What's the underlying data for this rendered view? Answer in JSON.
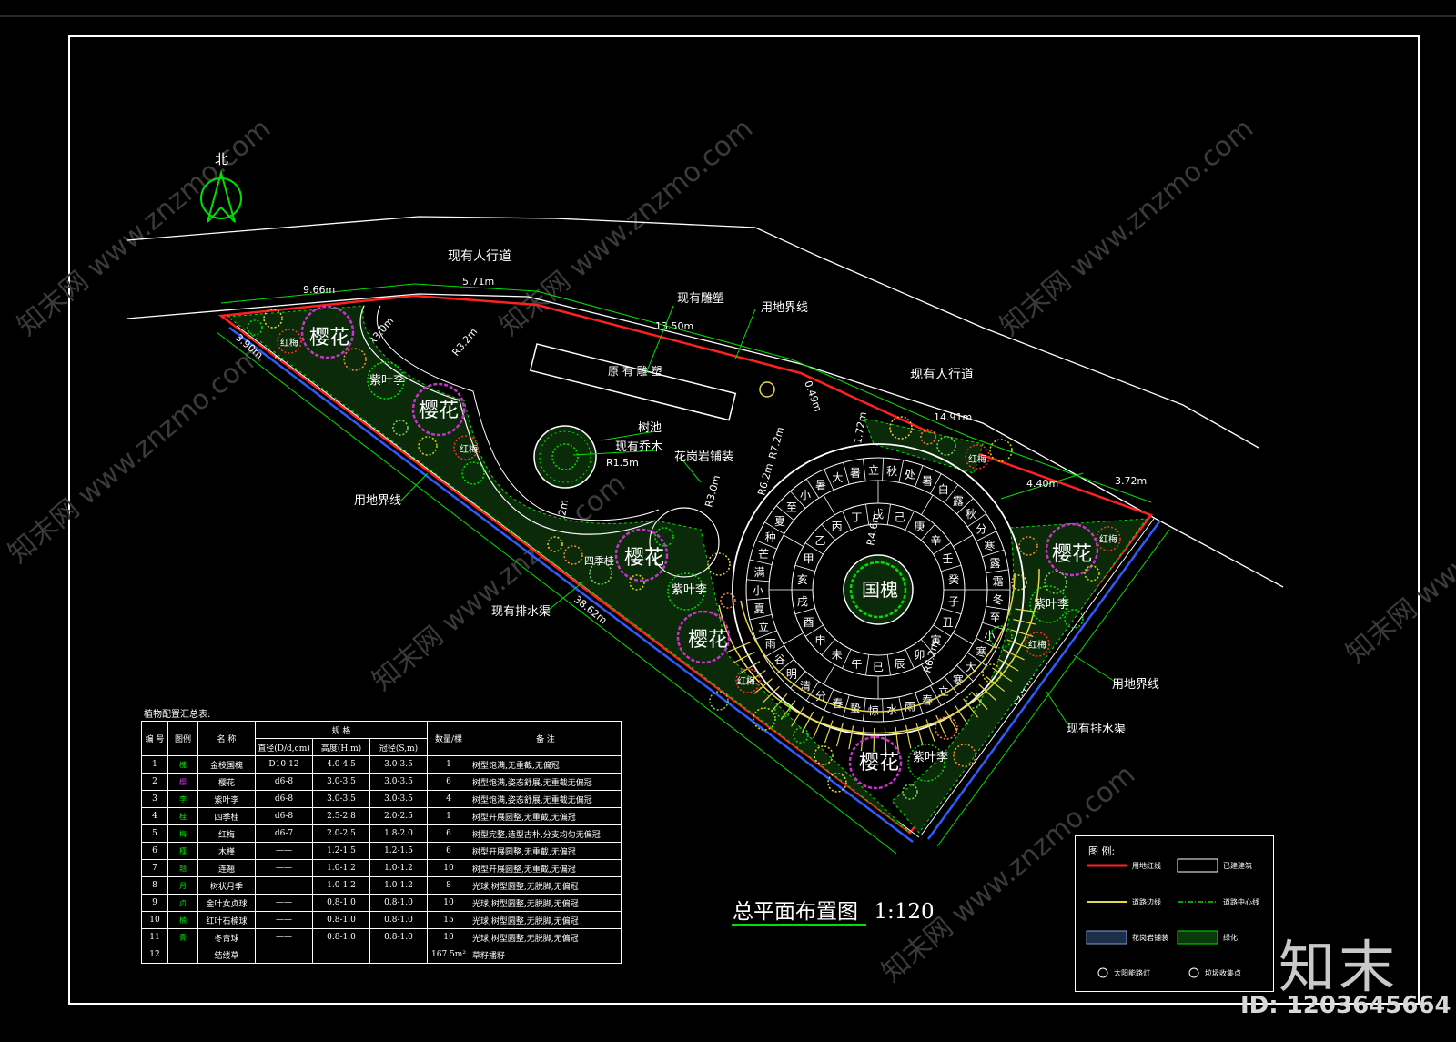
{
  "labels": {
    "north": "北",
    "sidewalk_top": "现有人行道",
    "sidewalk_right": "现有人行道",
    "sculpture": "现有雕塑",
    "boundary_top": "用地界线",
    "boundary_left": "用地界线",
    "boundary_right": "用地界线",
    "drain_left": "现有排水渠",
    "drain_right": "现有排水渠",
    "orig_corridor": "原 有 雕 塑",
    "tree_pool": "树池",
    "existing_tree": "现有乔木",
    "granite": "花岗岩铺装",
    "center_tree": "国槐"
  },
  "dims": {
    "d1": "9.66m",
    "d2": "5.71m",
    "d3": "13.50m",
    "d4": "0.49m",
    "d5": "14.91m",
    "d6": "3.72m",
    "d7": "4.40m",
    "d8": "1.72m",
    "d9": "3.90m",
    "d10": "1.72m",
    "d11": "38.62m",
    "d12": "19.44m",
    "r1": "R3.0m",
    "r2": "R3.2m",
    "r3": "R1.5m",
    "r4": "R5.2m",
    "r5": "R3.0m",
    "r6": "R7.2m",
    "r7": "R6.2m",
    "r8": "R4.6m",
    "r9": "R6.2m"
  },
  "plants": {
    "sakura": "樱花",
    "plum": "紫叶李",
    "redplum": "红梅",
    "osmanthus": "四季桂"
  },
  "table": {
    "title": "植物配置汇总表:",
    "headers": {
      "no": "编 号",
      "legend": "图例",
      "name": "名 称",
      "spec": "规 格",
      "dia": "直径(D/d,cm)",
      "height": "高度(H,m)",
      "crown": "冠径(S,m)",
      "qty": "数量/棵",
      "note": "备 注"
    },
    "rows": [
      {
        "no": "1",
        "icon": "槐",
        "name": "金枝国槐",
        "dia": "D10-12",
        "h": "4.0-4.5",
        "s": "3.0-3.5",
        "q": "1",
        "note": "树型饱满,无重截,无偏冠"
      },
      {
        "no": "2",
        "icon": "樱",
        "name": "樱花",
        "dia": "d6-8",
        "h": "3.0-3.5",
        "s": "3.0-3.5",
        "q": "6",
        "note": "树型饱满,姿态舒展,无重截无偏冠"
      },
      {
        "no": "3",
        "icon": "李",
        "name": "紫叶李",
        "dia": "d6-8",
        "h": "3.0-3.5",
        "s": "3.0-3.5",
        "q": "4",
        "note": "树型饱满,姿态舒展,无重截无偏冠"
      },
      {
        "no": "4",
        "icon": "桂",
        "name": "四季桂",
        "dia": "d6-8",
        "h": "2.5-2.8",
        "s": "2.0-2.5",
        "q": "1",
        "note": "树型开展圆整,无重截,无偏冠"
      },
      {
        "no": "5",
        "icon": "梅",
        "name": "红梅",
        "dia": "d6-7",
        "h": "2.0-2.5",
        "s": "1.8-2.0",
        "q": "6",
        "note": "树型完整,造型古朴,分支均匀无偏冠"
      },
      {
        "no": "6",
        "icon": "槿",
        "name": "木槿",
        "dia": "——",
        "h": "1.2-1.5",
        "s": "1.2-1.5",
        "q": "6",
        "note": "树型开展圆整,无重截,无偏冠"
      },
      {
        "no": "7",
        "icon": "翘",
        "name": "连翘",
        "dia": "——",
        "h": "1.0-1.2",
        "s": "1.0-1.2",
        "q": "10",
        "note": "树型开展圆整,无重截,无偏冠"
      },
      {
        "no": "8",
        "icon": "月",
        "name": "树状月季",
        "dia": "——",
        "h": "1.0-1.2",
        "s": "1.0-1.2",
        "q": "8",
        "note": "光球,树型圆整,无脱脚,无偏冠"
      },
      {
        "no": "9",
        "icon": "贞",
        "name": "金叶女贞球",
        "dia": "——",
        "h": "0.8-1.0",
        "s": "0.8-1.0",
        "q": "10",
        "note": "光球,树型圆整,无脱脚,无偏冠"
      },
      {
        "no": "10",
        "icon": "楠",
        "name": "红叶石楠球",
        "dia": "——",
        "h": "0.8-1.0",
        "s": "0.8-1.0",
        "q": "15",
        "note": "光球,树型圆整,无脱脚,无偏冠"
      },
      {
        "no": "11",
        "icon": "青",
        "name": "冬青球",
        "dia": "——",
        "h": "0.8-1.0",
        "s": "0.8-1.0",
        "q": "10",
        "note": "光球,树型圆整,无脱脚,无偏冠"
      },
      {
        "no": "12",
        "icon": "",
        "name": "结缕草",
        "dia": "",
        "h": "",
        "s": "",
        "q": "167.5m²",
        "note": "草籽播籽"
      }
    ]
  },
  "legend": {
    "title": "图 例:",
    "items": [
      "用地红线",
      "已建建筑",
      "道路边线",
      "道路中心线",
      "花岗岩铺装",
      "绿化",
      "太阳能路灯",
      "垃圾收集点"
    ]
  },
  "drawing_title": "总平面布置图",
  "scale": "1:120",
  "brand": "知末",
  "id_text": "ID: 1203645664",
  "watermark": "知末网 www.znzmo.com",
  "colors": {
    "background": "#000000",
    "boundary_red": "#ff2020",
    "dim_green": "#00e000",
    "road_white": "#ffffff",
    "deck_yellow": "#e6d84a",
    "drain_blue": "#2e5cff",
    "sakura_magenta": "#cc33cc"
  },
  "paving": {
    "outer_ring": [
      "冬",
      "至",
      "小",
      "寒",
      "大",
      "寒",
      "立",
      "春",
      "雨",
      "水",
      "惊",
      "蛰",
      "春",
      "分",
      "清",
      "明",
      "谷",
      "雨",
      "立",
      "夏",
      "小",
      "满",
      "芒",
      "种",
      "夏",
      "至",
      "小",
      "暑",
      "大",
      "暑",
      "立",
      "秋",
      "处",
      "暑",
      "白",
      "露",
      "秋",
      "分",
      "寒",
      "露",
      "霜"
    ],
    "inner_ring": [
      "子",
      "丑",
      "寅",
      "卯",
      "辰",
      "巳",
      "午",
      "未",
      "申",
      "酉",
      "戌",
      "亥",
      "甲",
      "乙",
      "丙",
      "丁",
      "戊",
      "己",
      "庚",
      "辛",
      "壬",
      "癸"
    ]
  }
}
